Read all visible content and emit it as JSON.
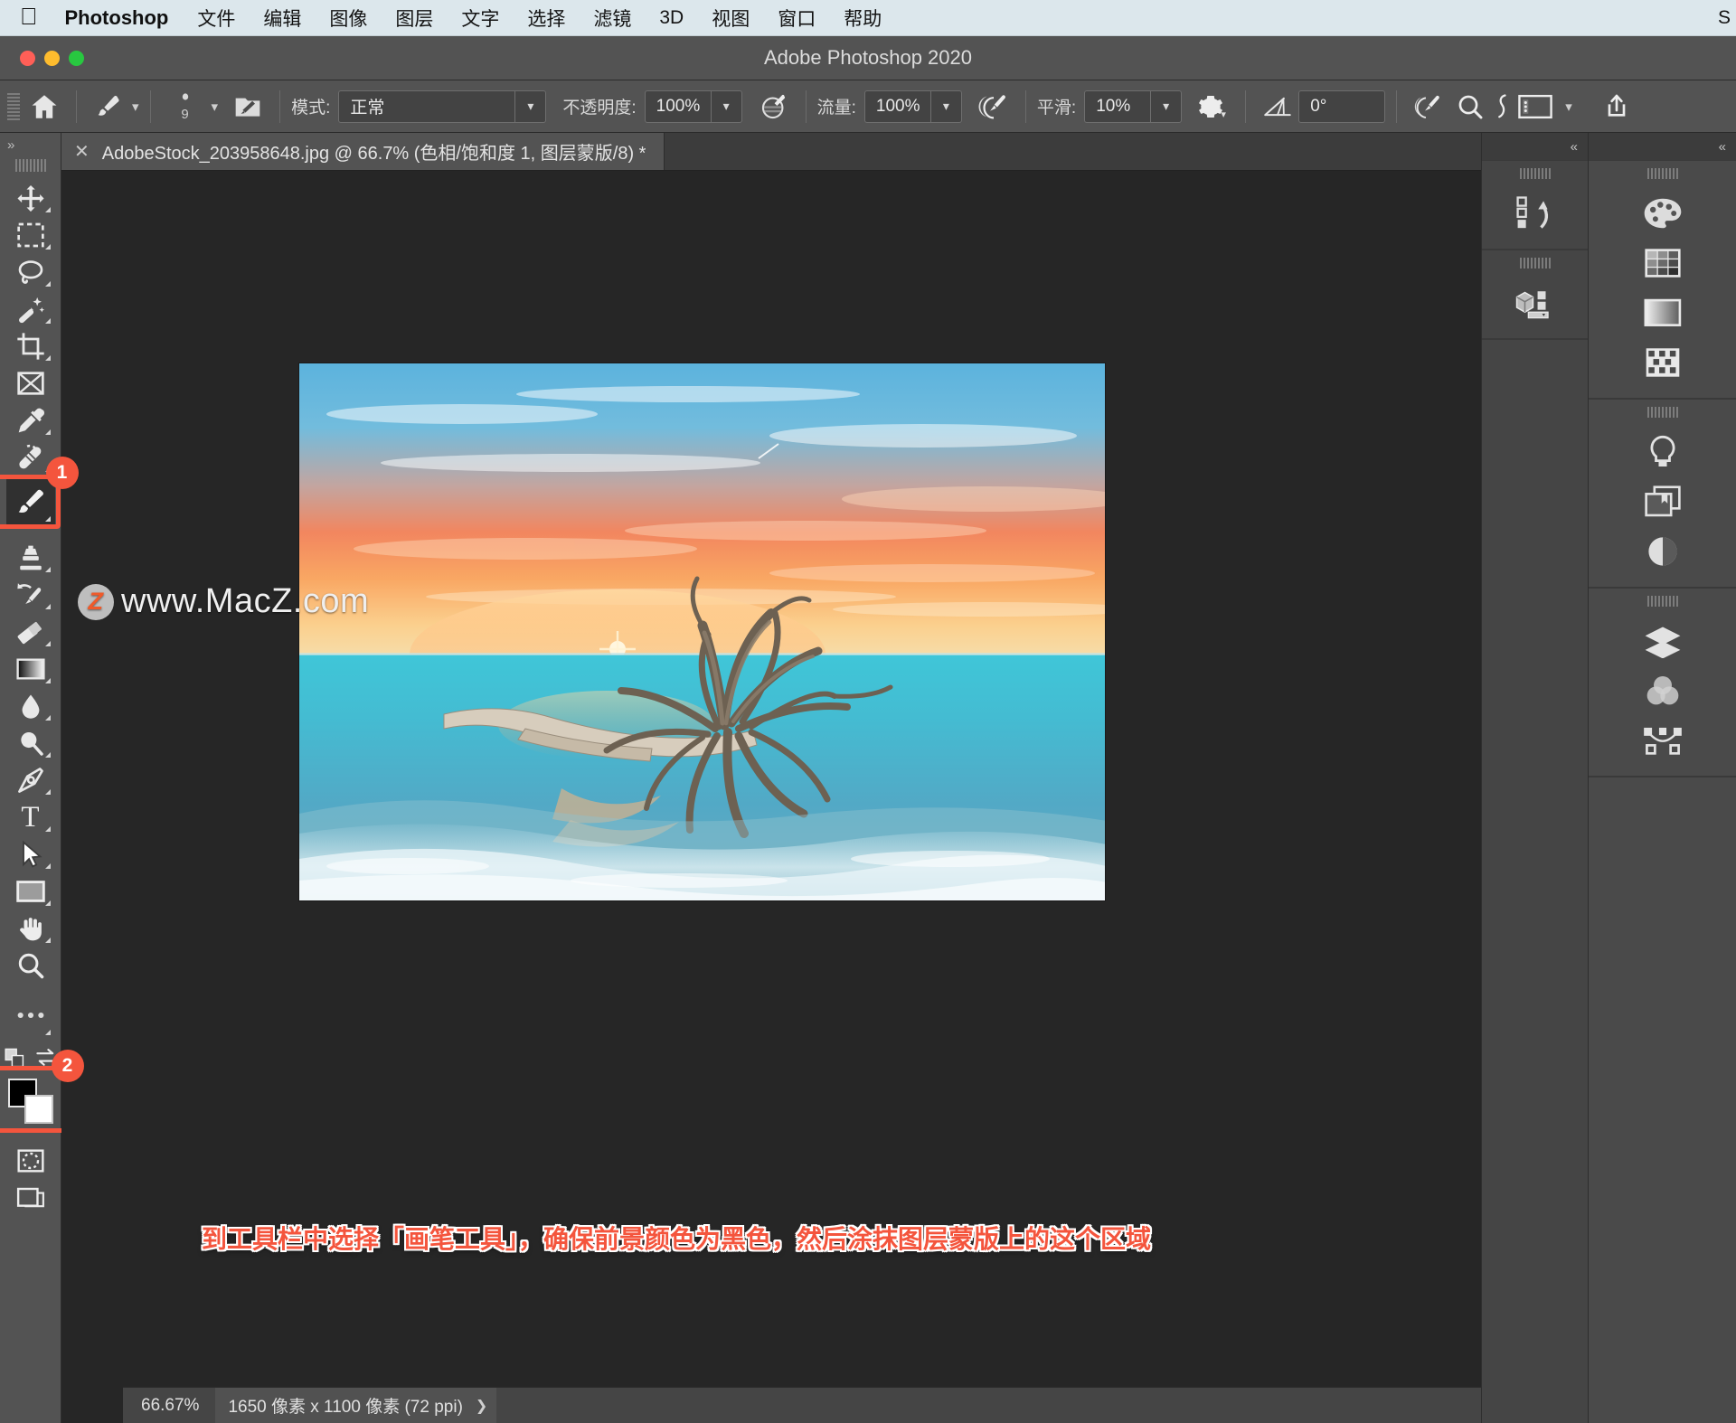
{
  "mac_menu": {
    "apple_icon": "apple-logo",
    "app_name": "Photoshop",
    "items": [
      "文件",
      "编辑",
      "图像",
      "图层",
      "文字",
      "选择",
      "滤镜",
      "3D",
      "视图",
      "窗口",
      "帮助"
    ],
    "right_edge": "S"
  },
  "window": {
    "title": "Adobe Photoshop 2020",
    "traffic_lights": [
      "close",
      "minimize",
      "zoom"
    ]
  },
  "options_bar": {
    "home_icon": "home-icon",
    "brush_preset_icon": "brush-icon",
    "brush_size_label": "9",
    "brush_panel_icon": "brush-settings-panel-icon",
    "mode_label": "模式:",
    "mode_value": "正常",
    "opacity_label": "不透明度:",
    "opacity_value": "100%",
    "pressure_opacity_icon": "tablet-pressure-opacity-icon",
    "flow_label": "流量:",
    "flow_value": "100%",
    "airbrush_icon": "airbrush-icon",
    "smoothing_label": "平滑:",
    "smoothing_value": "10%",
    "smoothing_options_icon": "gear-icon",
    "angle_icon": "angle-icon",
    "angle_value": "0°",
    "pressure_size_icon": "tablet-pressure-size-icon",
    "symmetry_icon": "symmetry-icon",
    "workspace_icon": "workspace-switcher-icon",
    "share_icon": "share-icon"
  },
  "toolbar": {
    "collapse_label": "»",
    "tools": [
      {
        "name": "move-tool",
        "icon": "move-icon",
        "has_flyout": true
      },
      {
        "name": "marquee-tool",
        "icon": "rectangular-marquee-icon",
        "has_flyout": true
      },
      {
        "name": "lasso-tool",
        "icon": "lasso-icon",
        "has_flyout": true
      },
      {
        "name": "quick-selection-tool",
        "icon": "magic-wand-icon",
        "has_flyout": true
      },
      {
        "name": "crop-tool",
        "icon": "crop-icon",
        "has_flyout": true
      },
      {
        "name": "frame-tool",
        "icon": "frame-icon",
        "has_flyout": false
      },
      {
        "name": "eyedropper-tool",
        "icon": "eyedropper-icon",
        "has_flyout": true
      },
      {
        "name": "healing-brush-tool",
        "icon": "spot-healing-brush-icon",
        "has_flyout": true
      },
      {
        "name": "brush-tool",
        "icon": "paint-brush-icon",
        "has_flyout": true,
        "selected": true
      },
      {
        "name": "clone-stamp-tool",
        "icon": "clone-stamp-icon",
        "has_flyout": true
      },
      {
        "name": "history-brush-tool",
        "icon": "history-brush-icon",
        "has_flyout": true
      },
      {
        "name": "eraser-tool",
        "icon": "eraser-icon",
        "has_flyout": true
      },
      {
        "name": "gradient-tool",
        "icon": "gradient-icon",
        "has_flyout": true
      },
      {
        "name": "blur-tool",
        "icon": "blur-droplet-icon",
        "has_flyout": true
      },
      {
        "name": "dodge-tool",
        "icon": "dodge-icon",
        "has_flyout": true
      },
      {
        "name": "pen-tool",
        "icon": "pen-icon",
        "has_flyout": true
      },
      {
        "name": "type-tool",
        "icon": "type-t-icon",
        "has_flyout": true
      },
      {
        "name": "path-selection-tool",
        "icon": "path-arrow-icon",
        "has_flyout": true
      },
      {
        "name": "rectangle-tool",
        "icon": "rectangle-shape-icon",
        "has_flyout": true
      },
      {
        "name": "hand-tool",
        "icon": "hand-icon",
        "has_flyout": true
      },
      {
        "name": "zoom-tool",
        "icon": "magnifier-icon",
        "has_flyout": false
      },
      {
        "name": "edit-toolbar",
        "icon": "ellipsis-icon",
        "has_flyout": true
      }
    ],
    "default_colors_icon": "default-colors-icon",
    "swap_colors_icon": "swap-colors-icon",
    "foreground_color": "#000000",
    "background_color": "#ffffff",
    "quick_mask_icon": "quick-mask-icon",
    "screen_mode_icon": "screen-mode-icon"
  },
  "document": {
    "tab_close_icon": "close-icon",
    "tab_title": "AdobeStock_203958648.jpg @ 66.7% (色相/饱和度 1, 图层蒙版/8) *"
  },
  "canvas": {
    "watermark": "www.MacZ.com",
    "watermark_badge": "Z",
    "annotation": "到工具栏中选择「画笔工具」，确保前景颜色为黑色，然后涂抹图层蒙版上的这个区域"
  },
  "annotations": {
    "markers": [
      {
        "id": "1",
        "target": "brush-tool"
      },
      {
        "id": "2",
        "target": "foreground-background-color-swatches"
      }
    ],
    "highlight_color": "#f4553d"
  },
  "right_panels": {
    "collapse_left_label": "«",
    "collapse_right_label": "«",
    "column_a": [
      {
        "name": "history-panel-icon",
        "icon": "history-icon"
      },
      {
        "name": "3d-panel-icon",
        "icon": "cube-icon"
      }
    ],
    "column_b_group1": [
      {
        "name": "color-panel-icon",
        "icon": "palette-icon"
      },
      {
        "name": "swatches-panel-icon",
        "icon": "swatches-grid-icon"
      },
      {
        "name": "gradients-panel-icon",
        "icon": "gradient-icon"
      },
      {
        "name": "patterns-panel-icon",
        "icon": "pattern-icon"
      }
    ],
    "column_b_group2": [
      {
        "name": "adjustments-panel-icon",
        "icon": "lightbulb-icon"
      },
      {
        "name": "libraries-panel-icon",
        "icon": "libraries-icon"
      },
      {
        "name": "properties-panel-icon",
        "icon": "half-circle-icon"
      }
    ],
    "column_b_group3": [
      {
        "name": "layers-panel-icon",
        "icon": "layers-icon"
      },
      {
        "name": "channels-panel-icon",
        "icon": "channels-venn-icon"
      },
      {
        "name": "paths-panel-icon",
        "icon": "paths-icon"
      }
    ]
  },
  "status_bar": {
    "zoom": "66.67%",
    "dimensions": "1650 像素 x 1100 像素 (72 ppi)",
    "expand_icon": "chevron-right-icon"
  },
  "colors": {
    "accent": "#f4553d",
    "panel_bg": "#535353",
    "canvas_bg": "#262626",
    "menu_bg": "#dce7ec"
  }
}
